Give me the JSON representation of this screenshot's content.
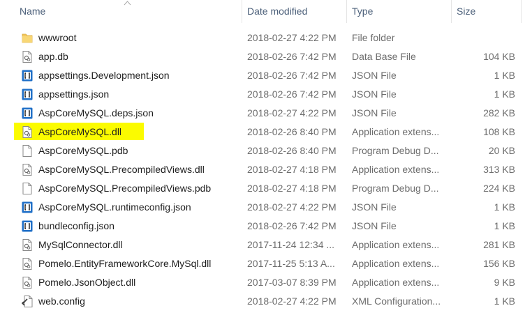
{
  "columns": {
    "name": "Name",
    "date": "Date modified",
    "type": "Type",
    "size": "Size"
  },
  "colors": {
    "header_text": "#4c607a",
    "highlight": "#fbfb00",
    "json_icon": "#1f6fc7",
    "folder_icon": "#f3c75f"
  },
  "files": [
    {
      "name": "wwwroot",
      "date": "2018-02-27 4:22 PM",
      "type": "File folder",
      "size": "",
      "icon": "folder-icon"
    },
    {
      "name": "app.db",
      "date": "2018-02-26 7:42 PM",
      "type": "Data Base File",
      "size": "104 KB",
      "icon": "gear-file-icon"
    },
    {
      "name": "appsettings.Development.json",
      "date": "2018-02-26 7:42 PM",
      "type": "JSON File",
      "size": "1 KB",
      "icon": "json-file-icon"
    },
    {
      "name": "appsettings.json",
      "date": "2018-02-26 7:42 PM",
      "type": "JSON File",
      "size": "1 KB",
      "icon": "json-file-icon"
    },
    {
      "name": "AspCoreMySQL.deps.json",
      "date": "2018-02-27 4:22 PM",
      "type": "JSON File",
      "size": "282 KB",
      "icon": "json-file-icon"
    },
    {
      "name": "AspCoreMySQL.dll",
      "date": "2018-02-26 8:40 PM",
      "type": "Application extens...",
      "size": "108 KB",
      "icon": "gear-file-icon",
      "highlighted": true
    },
    {
      "name": "AspCoreMySQL.pdb",
      "date": "2018-02-26 8:40 PM",
      "type": "Program Debug D...",
      "size": "20 KB",
      "icon": "blank-file-icon"
    },
    {
      "name": "AspCoreMySQL.PrecompiledViews.dll",
      "date": "2018-02-27 4:18 PM",
      "type": "Application extens...",
      "size": "313 KB",
      "icon": "gear-file-icon"
    },
    {
      "name": "AspCoreMySQL.PrecompiledViews.pdb",
      "date": "2018-02-27 4:18 PM",
      "type": "Program Debug D...",
      "size": "224 KB",
      "icon": "blank-file-icon"
    },
    {
      "name": "AspCoreMySQL.runtimeconfig.json",
      "date": "2018-02-27 4:22 PM",
      "type": "JSON File",
      "size": "1 KB",
      "icon": "json-file-icon"
    },
    {
      "name": "bundleconfig.json",
      "date": "2018-02-26 7:42 PM",
      "type": "JSON File",
      "size": "1 KB",
      "icon": "json-file-icon"
    },
    {
      "name": "MySqlConnector.dll",
      "date": "2017-11-24 12:34 ...",
      "type": "Application extens...",
      "size": "281 KB",
      "icon": "gear-file-icon"
    },
    {
      "name": "Pomelo.EntityFrameworkCore.MySql.dll",
      "date": "2017-11-25 5:13 A...",
      "type": "Application extens...",
      "size": "156 KB",
      "icon": "gear-file-icon"
    },
    {
      "name": "Pomelo.JsonObject.dll",
      "date": "2017-03-07 8:39 PM",
      "type": "Application extens...",
      "size": "9 KB",
      "icon": "gear-file-icon"
    },
    {
      "name": "web.config",
      "date": "2018-02-27 4:22 PM",
      "type": "XML Configuration...",
      "size": "1 KB",
      "icon": "config-file-icon"
    }
  ]
}
